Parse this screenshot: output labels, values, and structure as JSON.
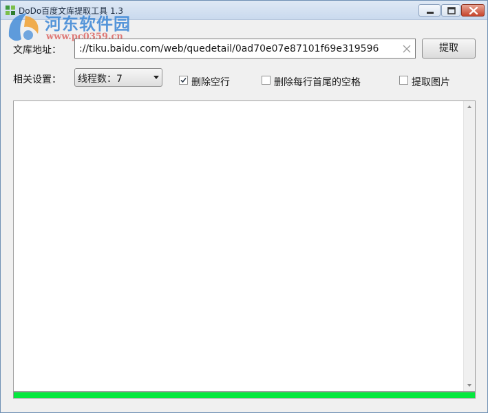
{
  "window": {
    "title": "DoDo百度文库提取工具  1.3"
  },
  "watermark": {
    "text": "河东软件园",
    "url": "www.pc0359.cn"
  },
  "form": {
    "url_label": "文库地址：",
    "url_value": "://tiku.baidu.com/web/quedetail/0ad70e07e87101f69e319596",
    "extract_button": "提取",
    "settings_label": "相关设置：",
    "thread_select": {
      "selected": "线程数：7"
    },
    "checkboxes": [
      {
        "label": "删除空行",
        "checked": true
      },
      {
        "label": "删除每行首尾的空格",
        "checked": false
      },
      {
        "label": "提取图片",
        "checked": false
      }
    ]
  },
  "output": {
    "text": ""
  },
  "progress": {
    "percent": 100
  },
  "colors": {
    "progress_fill": "#06e83e",
    "close_button": "#c6452c",
    "watermark_text": "#3a86d6",
    "watermark_url": "#d9534f"
  }
}
